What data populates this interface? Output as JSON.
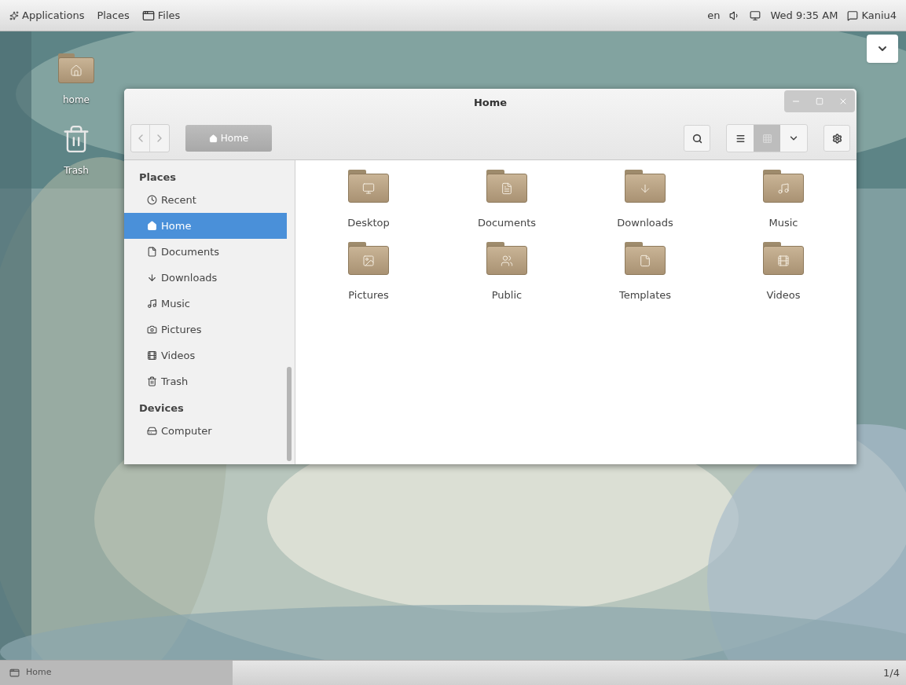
{
  "top_bar": {
    "menus": [
      {
        "label": "Applications",
        "kind": "apps"
      },
      {
        "label": "Places",
        "kind": "plain"
      },
      {
        "label": "Files",
        "kind": "files"
      }
    ],
    "keyboard": "en",
    "clock": "Wed 9:35 AM",
    "user": "Kaniu4"
  },
  "desktop_icons": [
    {
      "label": "home",
      "kind": "home"
    },
    {
      "label": "Trash",
      "kind": "trash"
    }
  ],
  "window": {
    "title": "Home",
    "path": [
      {
        "label": "Home",
        "selected": true
      }
    ],
    "view_buttons": [
      {
        "kind": "list",
        "selected": false
      },
      {
        "kind": "grid",
        "selected": true
      }
    ],
    "sidebar": [
      {
        "heading": "Places",
        "items": [
          {
            "label": "Recent",
            "kind": "recent",
            "selected": false
          },
          {
            "label": "Home",
            "kind": "home",
            "selected": true
          },
          {
            "label": "Documents",
            "kind": "documents",
            "selected": false
          },
          {
            "label": "Downloads",
            "kind": "downloads",
            "selected": false
          },
          {
            "label": "Music",
            "kind": "music",
            "selected": false
          },
          {
            "label": "Pictures",
            "kind": "pictures",
            "selected": false
          },
          {
            "label": "Videos",
            "kind": "videos",
            "selected": false
          },
          {
            "label": "Trash",
            "kind": "trash",
            "selected": false
          }
        ]
      },
      {
        "heading": "Devices",
        "items": [
          {
            "label": "Computer",
            "kind": "computer",
            "selected": false
          }
        ]
      }
    ],
    "files": [
      {
        "label": "Desktop",
        "kind": "desktop"
      },
      {
        "label": "Documents",
        "kind": "documents"
      },
      {
        "label": "Downloads",
        "kind": "downloads"
      },
      {
        "label": "Music",
        "kind": "music"
      },
      {
        "label": "Pictures",
        "kind": "pictures"
      },
      {
        "label": "Public",
        "kind": "public"
      },
      {
        "label": "Templates",
        "kind": "templates"
      },
      {
        "label": "Videos",
        "kind": "videos"
      }
    ]
  },
  "taskbar": {
    "tasks": [
      {
        "label": "Home",
        "selected": true
      }
    ],
    "workspace": "1/4"
  }
}
